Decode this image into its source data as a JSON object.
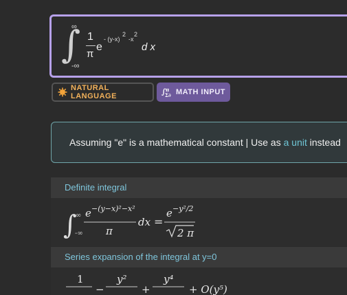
{
  "query": {
    "upper_limit": "∞",
    "lower_limit": "-∞",
    "numerator": "1",
    "denominator": "π",
    "base": "e",
    "exponent": "- (y-x)",
    "exp_square_1": "2",
    "exp_square_2": "2",
    "exp_minus_x": " -x",
    "differential": "d x"
  },
  "buttons": {
    "natural_language": "NATURAL LANGUAGE",
    "math_input": "MATH INPUT"
  },
  "assumption": {
    "prefix": "Assuming \"e\" is a mathematical constant | Use as ",
    "link": "a unit",
    "suffix": " instead"
  },
  "pods": {
    "definite_integral": {
      "title": "Definite integral",
      "lim_up": "∞",
      "lim_lo": "-∞",
      "lhs_num": "e",
      "lhs_exp": "−(y−x)²−x²",
      "lhs_den": "π",
      "dx": "dx",
      "eq": "=",
      "rhs_num": "e",
      "rhs_exp": "−y²/2",
      "rhs_den": "2 π"
    },
    "series": {
      "title": "Series expansion of the integral at y=0",
      "t1": "1",
      "op1": "−",
      "t2": "y²",
      "op2": "+",
      "t3": "y⁴",
      "op3": "+ O(y⁵)"
    }
  },
  "colors": {
    "input_border": "#b7a1ea",
    "natural_language": "#f2b15a",
    "math_input_bg": "#6e5a9c",
    "assumption_border": "#6fa6aa",
    "link": "#6fc6d6",
    "pod_title": "#7fc6dc"
  },
  "icons": {
    "natural_language": "sun-gear-icon",
    "math_input": "math-symbols-icon"
  }
}
